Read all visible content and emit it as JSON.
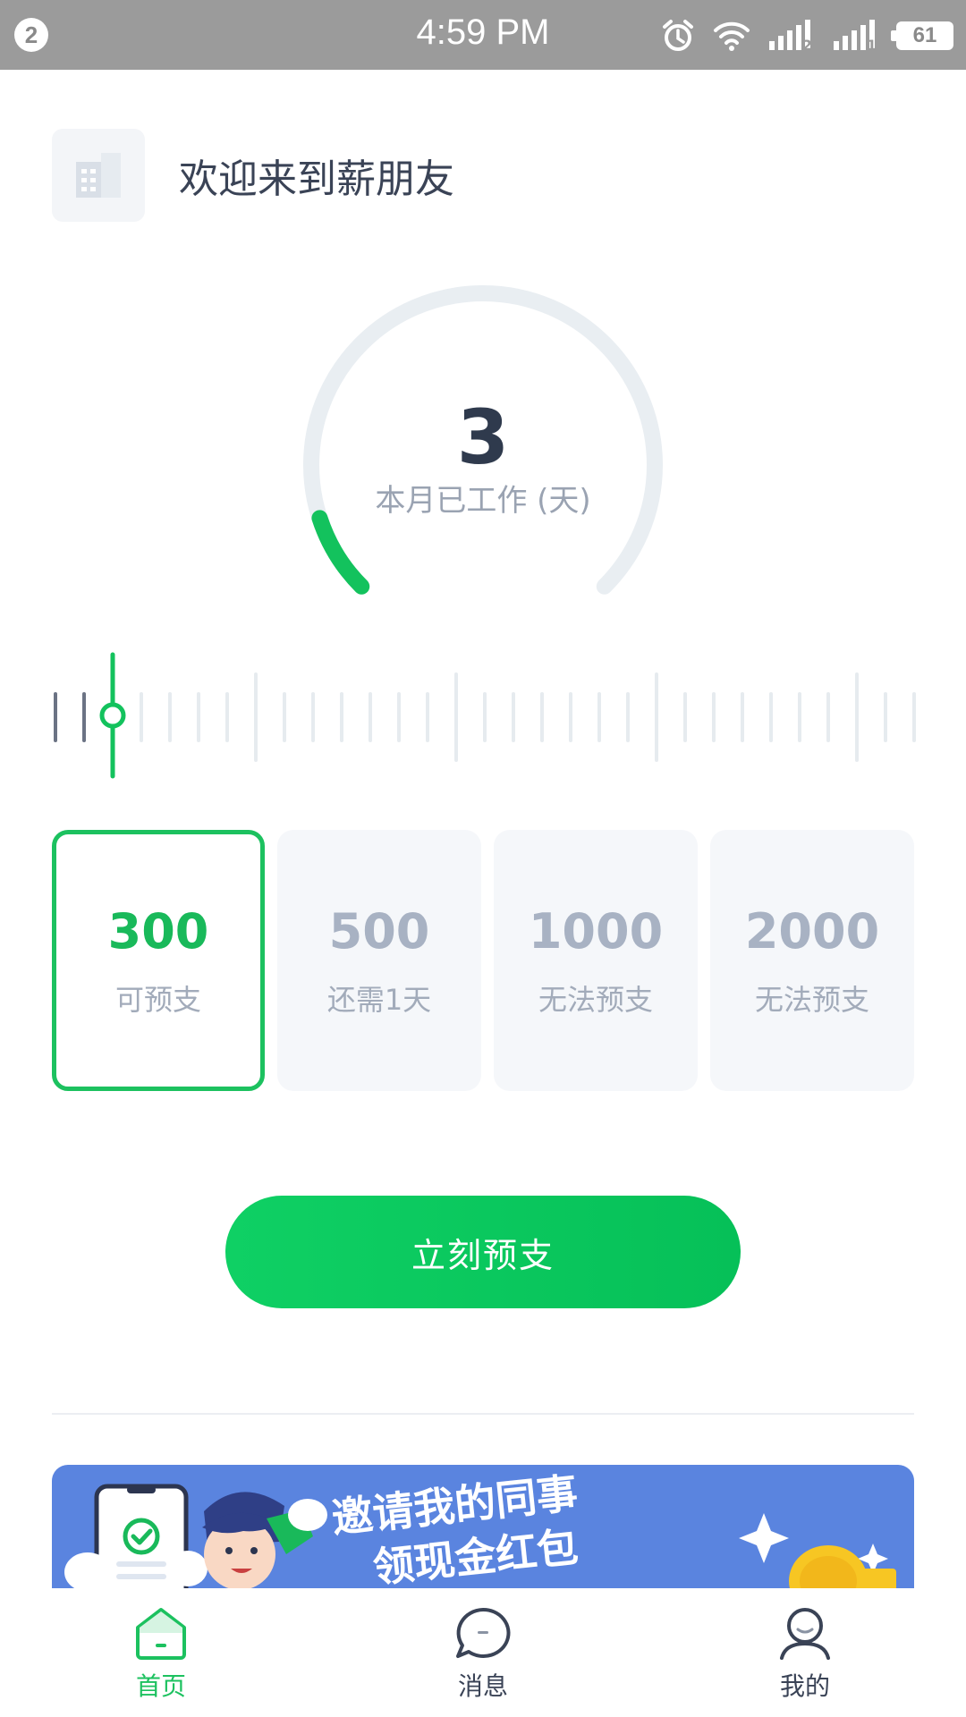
{
  "status_bar": {
    "notification_count": "2",
    "time": "4:59 PM",
    "battery": "61",
    "sim1_label": "2",
    "sim2_label": "1"
  },
  "header": {
    "welcome": "欢迎来到薪朋友",
    "logo_icon": "building-icon"
  },
  "gauge": {
    "value": "3",
    "label": "本月已工作 (天)",
    "progress_fraction": 0.1,
    "track_color": "#e9eef2",
    "progress_color": "#13c25d"
  },
  "ruler": {
    "current_day": 3,
    "total_days": 31,
    "active_color": "#13c25d",
    "past_color": "#6b7384",
    "future_color": "#e6ebef"
  },
  "amount_options": [
    {
      "amount": "300",
      "status": "可预支",
      "selected": true
    },
    {
      "amount": "500",
      "status": "还需1天",
      "selected": false
    },
    {
      "amount": "1000",
      "status": "无法预支",
      "selected": false
    },
    {
      "amount": "2000",
      "status": "无法预支",
      "selected": false
    }
  ],
  "cta": {
    "label": "立刻预支"
  },
  "banner": {
    "line1": "邀请我的同事",
    "line2": "领现金红包",
    "background": "#5a84df"
  },
  "bottom_nav": {
    "items": [
      {
        "label": "首页",
        "icon": "home-icon",
        "active": true
      },
      {
        "label": "消息",
        "icon": "message-icon",
        "active": false
      },
      {
        "label": "我的",
        "icon": "profile-icon",
        "active": false
      }
    ]
  },
  "colors": {
    "accent": "#1cc15f",
    "text_primary": "#3a4356",
    "text_muted": "#a2abba"
  }
}
